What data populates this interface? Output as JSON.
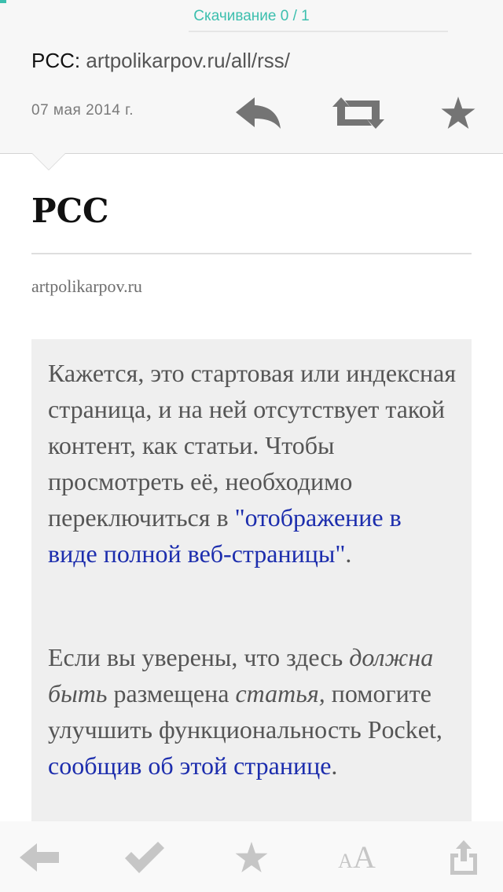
{
  "header": {
    "download_status": "Скачивание 0 / 1",
    "feed_name": "PCC:",
    "feed_url": "artpolikarpov.ru/all/rss/",
    "date": "07 мая 2014 г.",
    "accent_color": "#3cbfae",
    "actions": [
      {
        "icon": "reply-icon"
      },
      {
        "icon": "repost-icon"
      },
      {
        "icon": "star-icon"
      }
    ]
  },
  "article": {
    "title": "PCC",
    "source": "artpolikarpov.ru",
    "notice": {
      "p1_text": "Кажется, это стартовая или индексная страница, и на ней отсутствует такой контент, как статьи. Чтобы просмотреть её, необходимо переключиться в ",
      "p1_link": "\"отображение в виде полной веб-страницы\"",
      "p1_end": ".",
      "p2_start": "Если вы уверены, что здесь ",
      "p2_em1": "должна быть",
      "p2_mid": " размещена ",
      "p2_em2": "статья,",
      "p2_rest": " помогите улучшить функциональность Pocket, ",
      "p2_link": "сообщив об этой странице",
      "p2_end": "."
    },
    "link_color": "#1c2dad"
  },
  "toolbar": {
    "items": [
      {
        "icon": "back-arrow-icon"
      },
      {
        "icon": "checkmark-icon"
      },
      {
        "icon": "star-icon"
      },
      {
        "icon": "font-size-icon",
        "small": "A",
        "big": "A"
      },
      {
        "icon": "share-icon"
      }
    ]
  }
}
